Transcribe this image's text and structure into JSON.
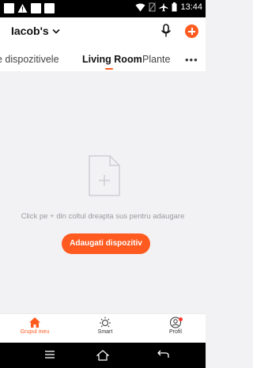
{
  "status_bar": {
    "time": "13:44",
    "icons": [
      "wifi-icon",
      "no-sim-icon",
      "airplane-icon",
      "battery-icon"
    ]
  },
  "header": {
    "home_name": "Iacob's",
    "icons": [
      "chevron-down-icon",
      "mic-icon",
      "add-icon"
    ]
  },
  "tabs": [
    {
      "label": "e dispozitivele",
      "active": false
    },
    {
      "label": "Living Room",
      "active": true
    },
    {
      "label": "Plante",
      "active": false
    }
  ],
  "empty_state": {
    "hint": "Click pe + din coltul dreapta sus pentru adaugare",
    "button_label": "Adaugati dispozitiv"
  },
  "bottom_nav": [
    {
      "label": "Grupul meu",
      "icon": "home-icon",
      "active": true
    },
    {
      "label": "Smart",
      "icon": "sun-icon",
      "active": false
    },
    {
      "label": "Profil",
      "icon": "profile-icon",
      "active": false
    }
  ],
  "colors": {
    "accent": "#ff5a1f",
    "background": "#f2f2f4",
    "hint_text": "#9a9aa0"
  }
}
